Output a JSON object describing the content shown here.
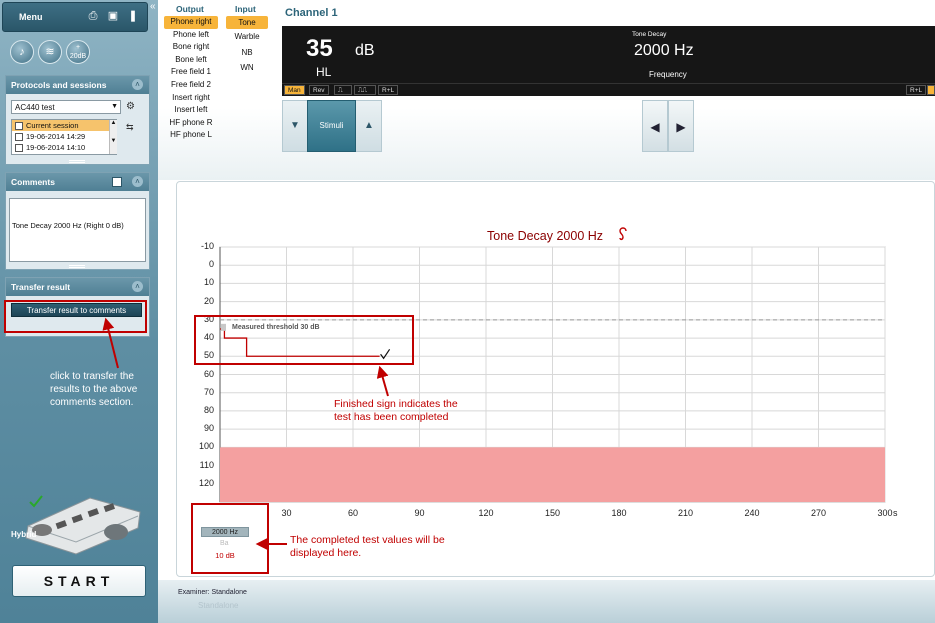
{
  "sidebar": {
    "menu_label": "Menu",
    "protocols": {
      "header": "Protocols and sessions",
      "selected_protocol": "AC440 test",
      "sessions": [
        "Current session",
        "19-06-2014 14:29",
        "19-06-2014 14:10"
      ]
    },
    "comments": {
      "header": "Comments",
      "text": "Tone Decay 2000 Hz (Right 0 dB)"
    },
    "transfer": {
      "header": "Transfer result",
      "button_label": "Transfer result to comments"
    },
    "note": "click to transfer the results to the above comments section.",
    "device_label": "Hybrid",
    "start_label": "START",
    "icons": [
      "print-icon",
      "save-icon",
      "book-icon",
      "music-note-icon",
      "tone-settings-icon",
      "add-20db-icon"
    ],
    "add_20db_label": "20dB"
  },
  "output": {
    "header": "Output",
    "options": [
      "Phone right",
      "Phone left",
      "Bone right",
      "Bone left",
      "Free field 1",
      "Free field 2",
      "Insert right",
      "Insert left",
      "HF phone R",
      "HF phone L"
    ],
    "selected": "Phone right"
  },
  "input": {
    "header": "Input",
    "options": [
      "Tone",
      "Warble",
      "NB",
      "WN"
    ],
    "selected": "Tone"
  },
  "channel": {
    "title": "Channel 1",
    "level_value": "35",
    "level_unit": "dB",
    "level_scale": "HL",
    "test_name": "Tone Decay",
    "frequency_value": "2000 Hz",
    "frequency_label": "Frequency",
    "tabs": [
      "Man",
      "Rev",
      "R+L"
    ],
    "right_tab": "R+L",
    "stimuli_label": "Stimuli"
  },
  "chart_data": {
    "type": "line",
    "title": "Tone Decay 2000 Hz",
    "ylabel": "dB",
    "xlabel": "s",
    "y_ticks": [
      -10,
      0,
      10,
      20,
      30,
      40,
      50,
      60,
      70,
      80,
      90,
      100,
      110,
      120
    ],
    "x_ticks": [
      30,
      60,
      90,
      120,
      150,
      180,
      210,
      240,
      270,
      300
    ],
    "ylim": [
      -10,
      130
    ],
    "xlim": [
      0,
      300
    ],
    "y_inverted": true,
    "grid": true,
    "threshold_db": 30,
    "threshold_label": "Measured threshold 30 dB",
    "series": [
      {
        "x": [
          0,
          2,
          2,
          12,
          12,
          72
        ],
        "y": [
          35,
          35,
          40,
          40,
          50,
          50
        ]
      }
    ],
    "finished_mark_x": 72,
    "finished_mark_y": 50,
    "shaded_region": {
      "from_db": 100,
      "to_db": 130,
      "color": "#f4a0a0"
    },
    "line_color": "#c00000"
  },
  "result": {
    "frequency": "2000 Hz",
    "faint_label": "Ba",
    "value": "10 dB"
  },
  "annotations": {
    "finished": "Finished sign indicates the test has been completed",
    "values": "The completed test values will be displayed here."
  },
  "footer": {
    "examiner": "Examiner:  Standalone",
    "ghost": "Standalone"
  },
  "colors": {
    "accent": "#f7b43a",
    "annotation_red": "#c00000",
    "title_red": "#8b0000",
    "sidebar": "#5e8ea3"
  }
}
